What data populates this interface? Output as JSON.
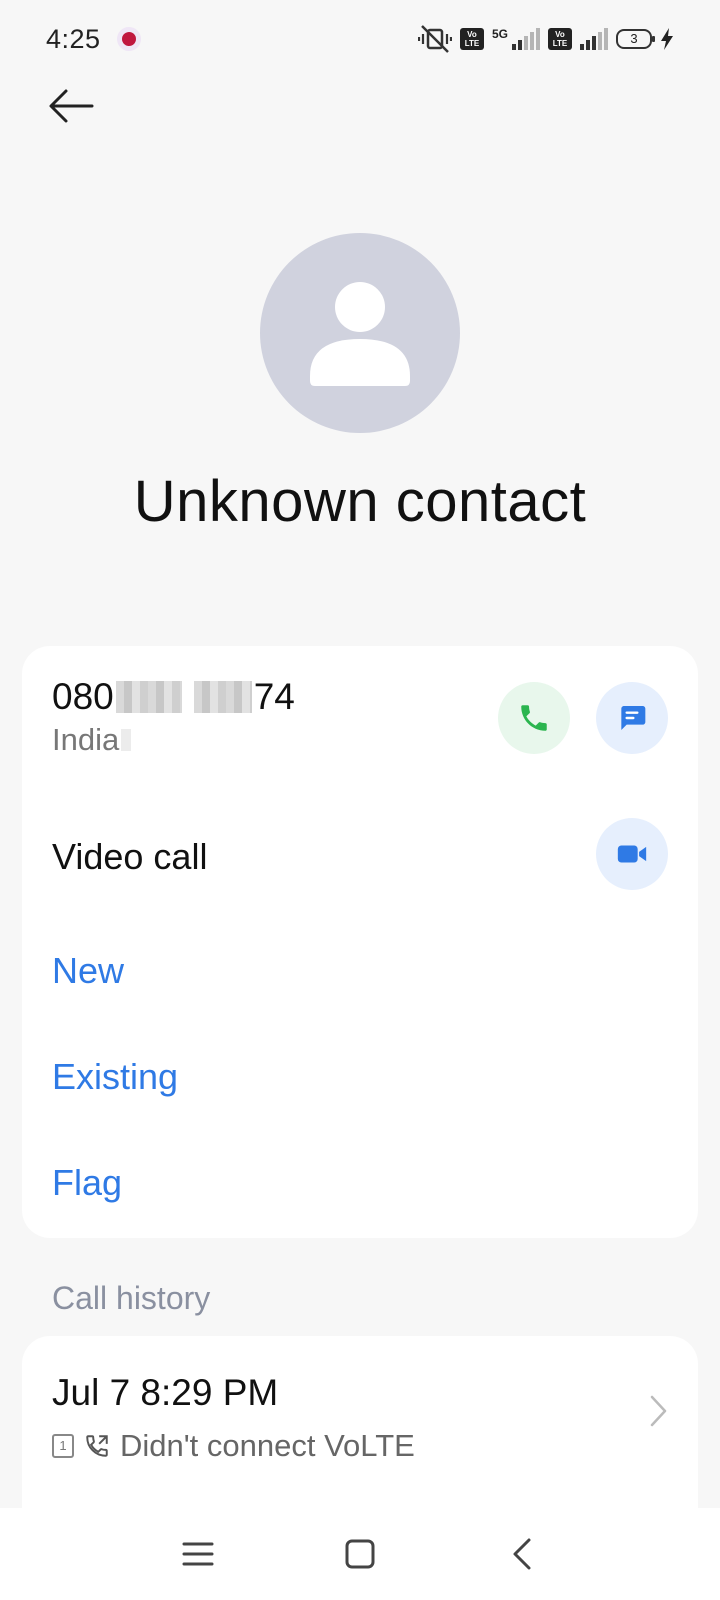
{
  "status_bar": {
    "time": "4:25",
    "network": "5G",
    "volte_label": "Vo LTE",
    "battery_level": "3"
  },
  "contact": {
    "name": "Unknown contact",
    "number_prefix": "080",
    "number_suffix": "74",
    "region": "India"
  },
  "actions": {
    "video_call_label": "Video call",
    "new_label": "New",
    "existing_label": "Existing",
    "flag_label": "Flag"
  },
  "call_history": {
    "section_label": "Call history",
    "entries": [
      {
        "time": "Jul 7 8:29 PM",
        "sim": "1",
        "status": "Didn't connect VoLTE"
      }
    ]
  },
  "colors": {
    "accent_blue": "#2f7ae5",
    "call_green": "#2bb54f",
    "avatar_bg": "#d0d2de"
  },
  "icons": {
    "back": "arrow-left-icon",
    "call": "phone-icon",
    "message": "message-icon",
    "video": "video-camera-icon",
    "nav_menu": "menu-icon",
    "nav_home": "home-icon",
    "nav_back": "back-icon"
  }
}
